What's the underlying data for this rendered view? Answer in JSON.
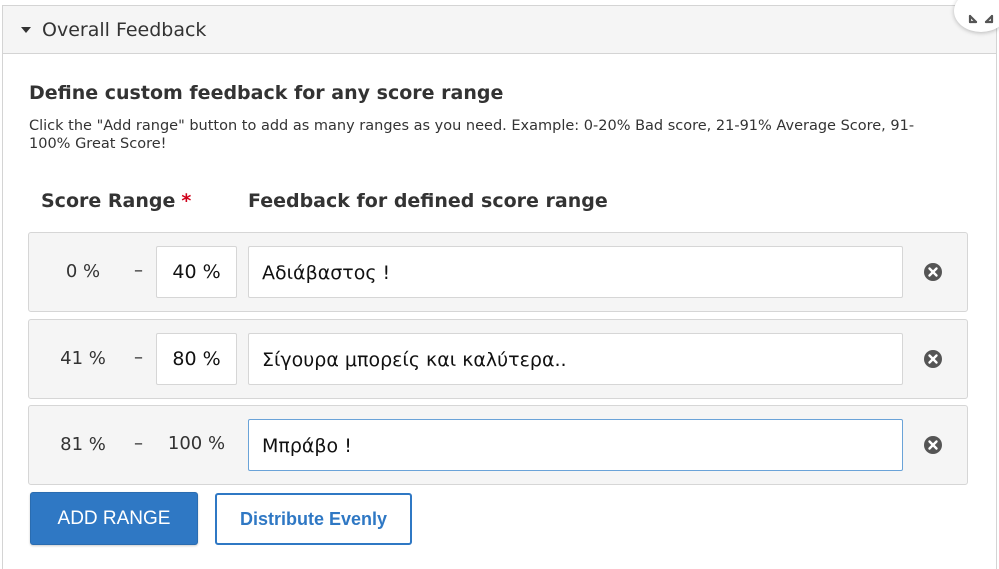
{
  "panel": {
    "title": "Overall Feedback"
  },
  "section": {
    "title": "Define custom feedback for any score range",
    "description": "Click the \"Add range\" button to add as many ranges as you need. Example: 0-20% Bad score, 21-91% Average Score, 91-100% Great Score!"
  },
  "columns": {
    "score_range": "Score Range",
    "required_mark": "*",
    "feedback": "Feedback for defined score range"
  },
  "ranges": [
    {
      "from": "0 %",
      "dash": "–",
      "to": "40 %",
      "feedback": "Αδιάβαστος !"
    },
    {
      "from": "41 %",
      "dash": "–",
      "to": "80 %",
      "feedback": "Σίγουρα μπορείς και καλύτερα.."
    },
    {
      "from": "81 %",
      "dash": "–",
      "to": "100 %",
      "feedback": "Μπράβο !"
    }
  ],
  "buttons": {
    "add_range": "ADD RANGE",
    "distribute": "Distribute Evenly"
  },
  "icons": {
    "collapse": "caret-down-icon",
    "expand": "expand-arrows-icon",
    "remove": "remove-circle-icon"
  },
  "colors": {
    "primary": "#2f78c4",
    "required": "#d0021b",
    "row_bg": "#f5f5f5"
  }
}
